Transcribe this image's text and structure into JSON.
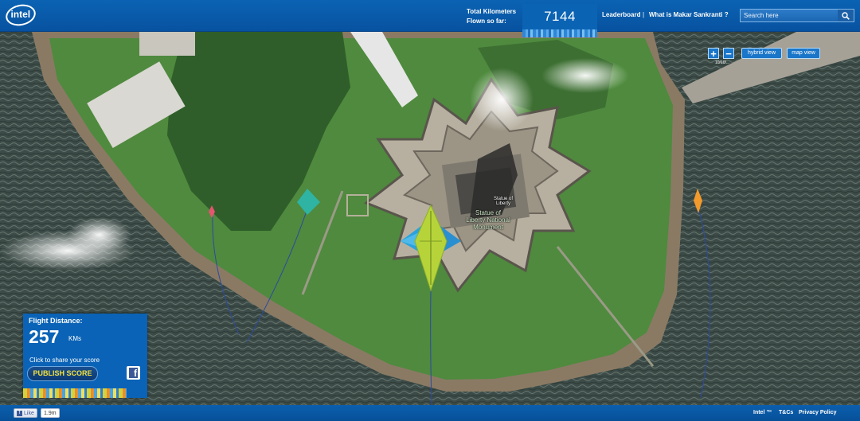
{
  "header": {
    "logo_text": "intel",
    "km_label_line1": "Total Kilometers",
    "km_label_line2": "Flown so far:",
    "km_total": "7144",
    "nav": {
      "leaderboard": "Leaderboard",
      "separator": "|",
      "what_is": "What is Makar Sankranti ?"
    },
    "search": {
      "placeholder": "Search here",
      "icon": "search-icon"
    }
  },
  "map": {
    "controls": {
      "zoom_in": "+",
      "zoom_out": "−",
      "zoom_caption": "10/10/...",
      "hybrid_view": "hybrid view",
      "map_view": "map view"
    },
    "labels": {
      "statue_small": "Statue of Liberty",
      "monument": "Statue of Liberty National Monument"
    },
    "kite_colors": {
      "main": "#b6d43a",
      "main_wings": "#2aa3dc",
      "teal": "#2fb3a2",
      "pink": "#e4556f",
      "orange": "#f39a2c"
    }
  },
  "flight_panel": {
    "title": "Flight Distance:",
    "distance": "257",
    "unit": "KMs",
    "share_text": "Click to share your score",
    "publish_label": "PUBLISH SCORE",
    "facebook_icon": "facebook-icon"
  },
  "footer": {
    "like_label": "Like",
    "like_count": "1.9m",
    "intel_link": "Intel ™",
    "tc_link": "T&Cs",
    "privacy_link": "Privacy Policy"
  },
  "colors": {
    "brand_blue": "#0b63b3",
    "water": "#3f4f4a",
    "grass": "#4f8a3e"
  }
}
